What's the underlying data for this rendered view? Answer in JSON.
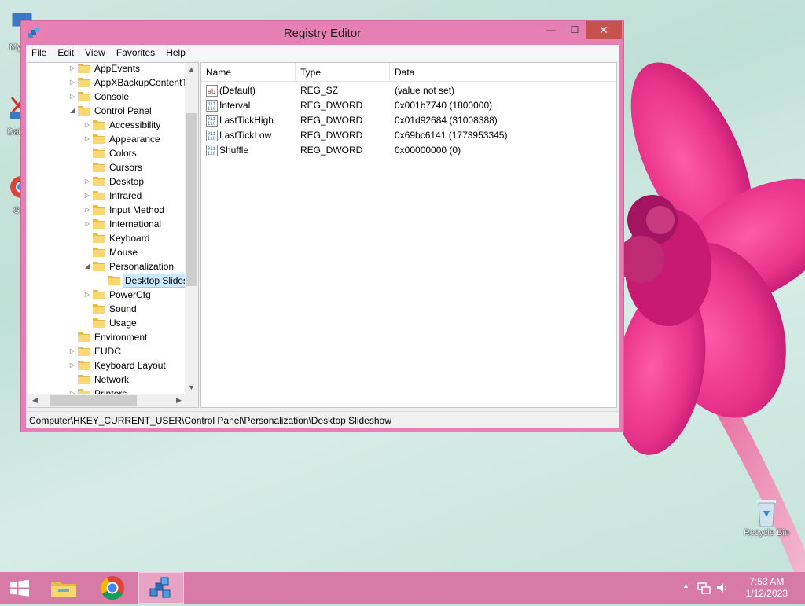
{
  "desktop": {
    "icons": [
      {
        "label": "My C"
      },
      {
        "label": "Data"
      },
      {
        "label": "G"
      },
      {
        "label": "Recycle Bin"
      }
    ]
  },
  "window": {
    "title": "Registry Editor",
    "controls": {
      "minimize": "—",
      "maximize": "☐",
      "close": "✕"
    },
    "menu": [
      "File",
      "Edit",
      "View",
      "Favorites",
      "Help"
    ],
    "tree": [
      {
        "label": "AppEvents",
        "level": 0,
        "expander": "collapsed"
      },
      {
        "label": "AppXBackupContentT",
        "level": 0,
        "expander": "collapsed"
      },
      {
        "label": "Console",
        "level": 0,
        "expander": "collapsed"
      },
      {
        "label": "Control Panel",
        "level": 0,
        "expander": "expanded"
      },
      {
        "label": "Accessibility",
        "level": 1,
        "expander": "collapsed"
      },
      {
        "label": "Appearance",
        "level": 1,
        "expander": "collapsed"
      },
      {
        "label": "Colors",
        "level": 1,
        "expander": "none"
      },
      {
        "label": "Cursors",
        "level": 1,
        "expander": "none"
      },
      {
        "label": "Desktop",
        "level": 1,
        "expander": "collapsed"
      },
      {
        "label": "Infrared",
        "level": 1,
        "expander": "collapsed"
      },
      {
        "label": "Input Method",
        "level": 1,
        "expander": "collapsed"
      },
      {
        "label": "International",
        "level": 1,
        "expander": "collapsed"
      },
      {
        "label": "Keyboard",
        "level": 1,
        "expander": "none"
      },
      {
        "label": "Mouse",
        "level": 1,
        "expander": "none"
      },
      {
        "label": "Personalization",
        "level": 1,
        "expander": "expanded"
      },
      {
        "label": "Desktop Slides",
        "level": 2,
        "expander": "none",
        "selected": true
      },
      {
        "label": "PowerCfg",
        "level": 1,
        "expander": "collapsed"
      },
      {
        "label": "Sound",
        "level": 1,
        "expander": "none"
      },
      {
        "label": "Usage",
        "level": 1,
        "expander": "none"
      },
      {
        "label": "Environment",
        "level": 0,
        "expander": "none"
      },
      {
        "label": "EUDC",
        "level": 0,
        "expander": "collapsed"
      },
      {
        "label": "Keyboard Layout",
        "level": 0,
        "expander": "collapsed"
      },
      {
        "label": "Network",
        "level": 0,
        "expander": "none"
      },
      {
        "label": "Printers",
        "level": 0,
        "expander": "collapsed"
      }
    ],
    "list": {
      "headers": {
        "name": "Name",
        "type": "Type",
        "data": "Data"
      },
      "rows": [
        {
          "name": "(Default)",
          "type": "REG_SZ",
          "data": "(value not set)",
          "icon": "string-value-icon"
        },
        {
          "name": "Interval",
          "type": "REG_DWORD",
          "data": "0x001b7740 (1800000)",
          "icon": "binary-value-icon"
        },
        {
          "name": "LastTickHigh",
          "type": "REG_DWORD",
          "data": "0x01d92684 (31008388)",
          "icon": "binary-value-icon"
        },
        {
          "name": "LastTickLow",
          "type": "REG_DWORD",
          "data": "0x69bc6141 (1773953345)",
          "icon": "binary-value-icon"
        },
        {
          "name": "Shuffle",
          "type": "REG_DWORD",
          "data": "0x00000000 (0)",
          "icon": "binary-value-icon"
        }
      ]
    },
    "status": "Computer\\HKEY_CURRENT_USER\\Control Panel\\Personalization\\Desktop Slideshow"
  },
  "taskbar": {
    "items": [
      "start-button",
      "file-explorer",
      "chrome",
      "registry-editor"
    ],
    "active": "registry-editor",
    "clock": {
      "time": "7:53 AM",
      "date": "1/12/2023"
    }
  },
  "colors": {
    "window_frame": "#e67fb3",
    "taskbar": "#d77aa8",
    "close_button": "#c75050",
    "selection": "#cce8ff"
  }
}
